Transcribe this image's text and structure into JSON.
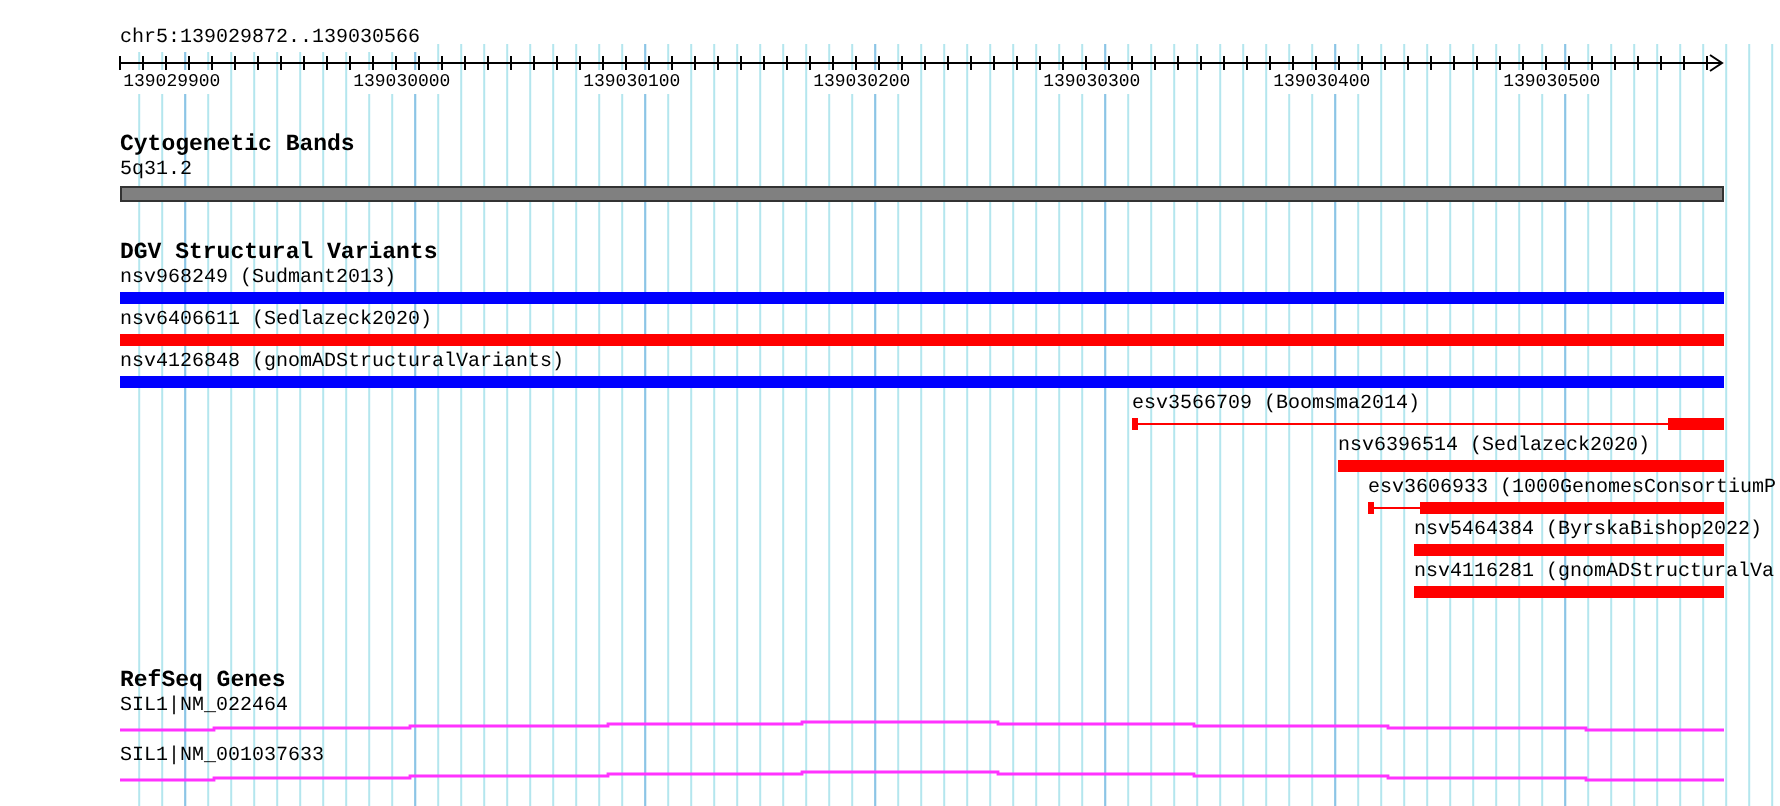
{
  "location": "chr5:139029872..139030566",
  "ruler_labels": [
    "139029900",
    "139030000",
    "139030100",
    "139030200",
    "139030300",
    "139030400",
    "139030500"
  ],
  "cytobands": {
    "title": "Cytogenetic Bands",
    "band": "5q31.2"
  },
  "variants": {
    "title": "DGV Structural Variants",
    "features": [
      {
        "label": "nsv968249 (Sudmant2013)",
        "color": "#0000ff",
        "kind": "bar"
      },
      {
        "label": "nsv6406611 (Sedlazeck2020)",
        "color": "#ff0000",
        "kind": "bar"
      },
      {
        "label": "nsv4126848 (gnomADStructuralVariants)",
        "color": "#0000ff",
        "kind": "bar"
      },
      {
        "label": "esv3566709 (Boomsma2014)",
        "color": "#ff0000",
        "kind": "gapped"
      },
      {
        "label": "nsv6396514 (Sedlazeck2020)",
        "color": "#ff0000",
        "kind": "bar"
      },
      {
        "label": "esv3606933 (1000GenomesConsortiumP",
        "color": "#ff0000",
        "kind": "gapped"
      },
      {
        "label": "nsv5464384 (ByrskaBishop2022)",
        "color": "#ff0000",
        "kind": "bar"
      },
      {
        "label": "nsv4116281 (gnomADStructuralVa",
        "color": "#ff0000",
        "kind": "bar"
      }
    ]
  },
  "genes": {
    "title": "RefSeq Genes",
    "transcripts": [
      {
        "label": "SIL1|NM_022464"
      },
      {
        "label": "SIL1|NM_001037633"
      }
    ]
  }
}
